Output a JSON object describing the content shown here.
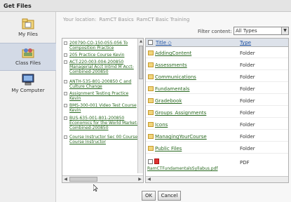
{
  "window": {
    "title": "Get Files"
  },
  "nav": {
    "items": [
      {
        "label": "My Files",
        "icon": "folder-files-icon",
        "selected": false
      },
      {
        "label": "Class Files",
        "icon": "class-files-icon",
        "selected": true
      },
      {
        "label": "My Computer",
        "icon": "computer-icon",
        "selected": false
      }
    ]
  },
  "location": {
    "label": "Your location:",
    "crumbs": [
      "RamCT Basics",
      "RamCT Basic Training"
    ]
  },
  "filter": {
    "label": "Filter content:",
    "value": "All Types"
  },
  "courses": [
    "200790-CO-150-055-056 To Composition Practice",
    "205 Practice Course Kevin",
    "ACT-220-003-004-200850 Managerial Acct Intmd M Acct-Combined-200850",
    "ANTH-535-801-200850 C and Culture Change",
    "Assignment Testing Practice Kevin",
    "BMS-300-001 Video Test Course Kevin",
    "BUS-635-001-801-200850 Economics for the World Market-Combined-200850",
    "Course Instructor Sec 00 Course Course Instructor"
  ],
  "files": {
    "headers": {
      "title": "Title",
      "type": "Type"
    },
    "rows": [
      {
        "name": "AddingContent",
        "type": "Folder"
      },
      {
        "name": "Assessments",
        "type": "Folder"
      },
      {
        "name": "Communications",
        "type": "Folder"
      },
      {
        "name": "Fundamentals",
        "type": "Folder"
      },
      {
        "name": "Gradebook",
        "type": "Folder"
      },
      {
        "name": "Groups_Assignments",
        "type": "Folder"
      },
      {
        "name": "Icons",
        "type": "Folder"
      },
      {
        "name": "ManagingYourCourse",
        "type": "Folder"
      },
      {
        "name": "Public Files",
        "type": "Folder"
      }
    ],
    "pdf": {
      "name": "RamCTFundamentalsSyllabus.pdf",
      "type": "PDF"
    }
  },
  "buttons": {
    "ok": "OK",
    "cancel": "Cancel"
  },
  "colors": {
    "link": "#2b6a22",
    "header_link": "#1b4fa0",
    "selected_nav": "#d3dae6"
  }
}
